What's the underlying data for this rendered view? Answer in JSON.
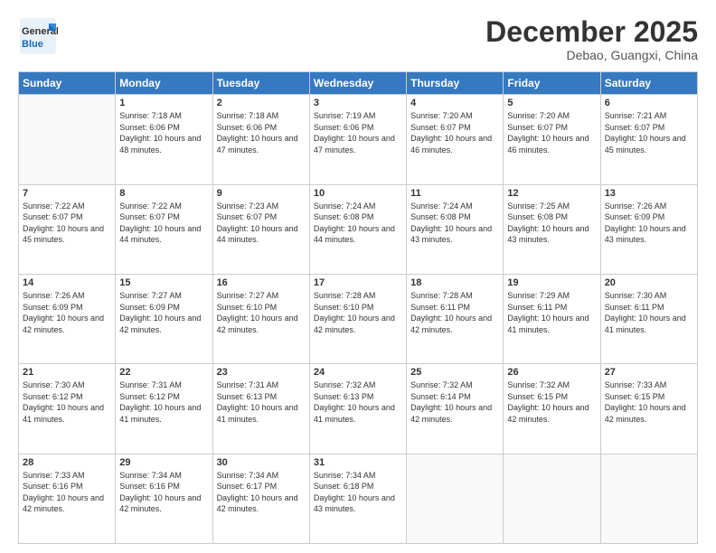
{
  "header": {
    "logo_general": "General",
    "logo_blue": "Blue",
    "month": "December 2025",
    "location": "Debao, Guangxi, China"
  },
  "days_of_week": [
    "Sunday",
    "Monday",
    "Tuesday",
    "Wednesday",
    "Thursday",
    "Friday",
    "Saturday"
  ],
  "weeks": [
    [
      {
        "day": "",
        "info": ""
      },
      {
        "day": "1",
        "info": "Sunrise: 7:18 AM\nSunset: 6:06 PM\nDaylight: 10 hours and 48 minutes."
      },
      {
        "day": "2",
        "info": "Sunrise: 7:18 AM\nSunset: 6:06 PM\nDaylight: 10 hours and 47 minutes."
      },
      {
        "day": "3",
        "info": "Sunrise: 7:19 AM\nSunset: 6:06 PM\nDaylight: 10 hours and 47 minutes."
      },
      {
        "day": "4",
        "info": "Sunrise: 7:20 AM\nSunset: 6:07 PM\nDaylight: 10 hours and 46 minutes."
      },
      {
        "day": "5",
        "info": "Sunrise: 7:20 AM\nSunset: 6:07 PM\nDaylight: 10 hours and 46 minutes."
      },
      {
        "day": "6",
        "info": "Sunrise: 7:21 AM\nSunset: 6:07 PM\nDaylight: 10 hours and 45 minutes."
      }
    ],
    [
      {
        "day": "7",
        "info": "Sunrise: 7:22 AM\nSunset: 6:07 PM\nDaylight: 10 hours and 45 minutes."
      },
      {
        "day": "8",
        "info": "Sunrise: 7:22 AM\nSunset: 6:07 PM\nDaylight: 10 hours and 44 minutes."
      },
      {
        "day": "9",
        "info": "Sunrise: 7:23 AM\nSunset: 6:07 PM\nDaylight: 10 hours and 44 minutes."
      },
      {
        "day": "10",
        "info": "Sunrise: 7:24 AM\nSunset: 6:08 PM\nDaylight: 10 hours and 44 minutes."
      },
      {
        "day": "11",
        "info": "Sunrise: 7:24 AM\nSunset: 6:08 PM\nDaylight: 10 hours and 43 minutes."
      },
      {
        "day": "12",
        "info": "Sunrise: 7:25 AM\nSunset: 6:08 PM\nDaylight: 10 hours and 43 minutes."
      },
      {
        "day": "13",
        "info": "Sunrise: 7:26 AM\nSunset: 6:09 PM\nDaylight: 10 hours and 43 minutes."
      }
    ],
    [
      {
        "day": "14",
        "info": "Sunrise: 7:26 AM\nSunset: 6:09 PM\nDaylight: 10 hours and 42 minutes."
      },
      {
        "day": "15",
        "info": "Sunrise: 7:27 AM\nSunset: 6:09 PM\nDaylight: 10 hours and 42 minutes."
      },
      {
        "day": "16",
        "info": "Sunrise: 7:27 AM\nSunset: 6:10 PM\nDaylight: 10 hours and 42 minutes."
      },
      {
        "day": "17",
        "info": "Sunrise: 7:28 AM\nSunset: 6:10 PM\nDaylight: 10 hours and 42 minutes."
      },
      {
        "day": "18",
        "info": "Sunrise: 7:28 AM\nSunset: 6:11 PM\nDaylight: 10 hours and 42 minutes."
      },
      {
        "day": "19",
        "info": "Sunrise: 7:29 AM\nSunset: 6:11 PM\nDaylight: 10 hours and 41 minutes."
      },
      {
        "day": "20",
        "info": "Sunrise: 7:30 AM\nSunset: 6:11 PM\nDaylight: 10 hours and 41 minutes."
      }
    ],
    [
      {
        "day": "21",
        "info": "Sunrise: 7:30 AM\nSunset: 6:12 PM\nDaylight: 10 hours and 41 minutes."
      },
      {
        "day": "22",
        "info": "Sunrise: 7:31 AM\nSunset: 6:12 PM\nDaylight: 10 hours and 41 minutes."
      },
      {
        "day": "23",
        "info": "Sunrise: 7:31 AM\nSunset: 6:13 PM\nDaylight: 10 hours and 41 minutes."
      },
      {
        "day": "24",
        "info": "Sunrise: 7:32 AM\nSunset: 6:13 PM\nDaylight: 10 hours and 41 minutes."
      },
      {
        "day": "25",
        "info": "Sunrise: 7:32 AM\nSunset: 6:14 PM\nDaylight: 10 hours and 42 minutes."
      },
      {
        "day": "26",
        "info": "Sunrise: 7:32 AM\nSunset: 6:15 PM\nDaylight: 10 hours and 42 minutes."
      },
      {
        "day": "27",
        "info": "Sunrise: 7:33 AM\nSunset: 6:15 PM\nDaylight: 10 hours and 42 minutes."
      }
    ],
    [
      {
        "day": "28",
        "info": "Sunrise: 7:33 AM\nSunset: 6:16 PM\nDaylight: 10 hours and 42 minutes."
      },
      {
        "day": "29",
        "info": "Sunrise: 7:34 AM\nSunset: 6:16 PM\nDaylight: 10 hours and 42 minutes."
      },
      {
        "day": "30",
        "info": "Sunrise: 7:34 AM\nSunset: 6:17 PM\nDaylight: 10 hours and 42 minutes."
      },
      {
        "day": "31",
        "info": "Sunrise: 7:34 AM\nSunset: 6:18 PM\nDaylight: 10 hours and 43 minutes."
      },
      {
        "day": "",
        "info": ""
      },
      {
        "day": "",
        "info": ""
      },
      {
        "day": "",
        "info": ""
      }
    ]
  ]
}
